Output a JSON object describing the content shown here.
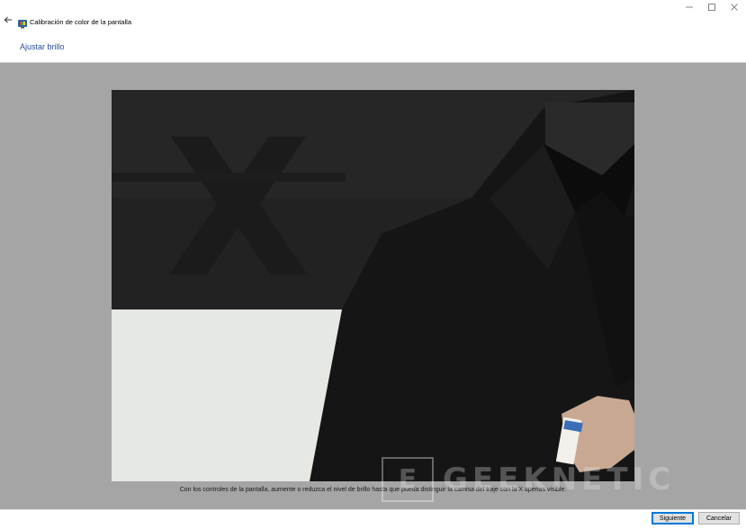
{
  "window": {
    "title": "Calibración de color de la pantalla"
  },
  "header": {
    "title": "Ajustar brillo"
  },
  "content": {
    "instruction": "Con los controles de la pantalla, aumente o reduzca el nivel de brillo hasta que pueda distinguir la camisa del traje con la X apenas visible.",
    "image_letter": "X"
  },
  "watermark": {
    "text": "GEEKNETIC",
    "box_letter": "E"
  },
  "footer": {
    "next_label": "Siguiente",
    "cancel_label": "Cancelar"
  },
  "icons": {
    "back": "back-arrow-icon",
    "app": "color-calibration-icon",
    "minimize": "minimize-icon",
    "maximize": "maximize-icon",
    "close": "close-icon"
  },
  "colors": {
    "title_accent": "#2b4c9f",
    "content_background": "#a5a5a5",
    "primary_button_border": "#0078d7"
  }
}
